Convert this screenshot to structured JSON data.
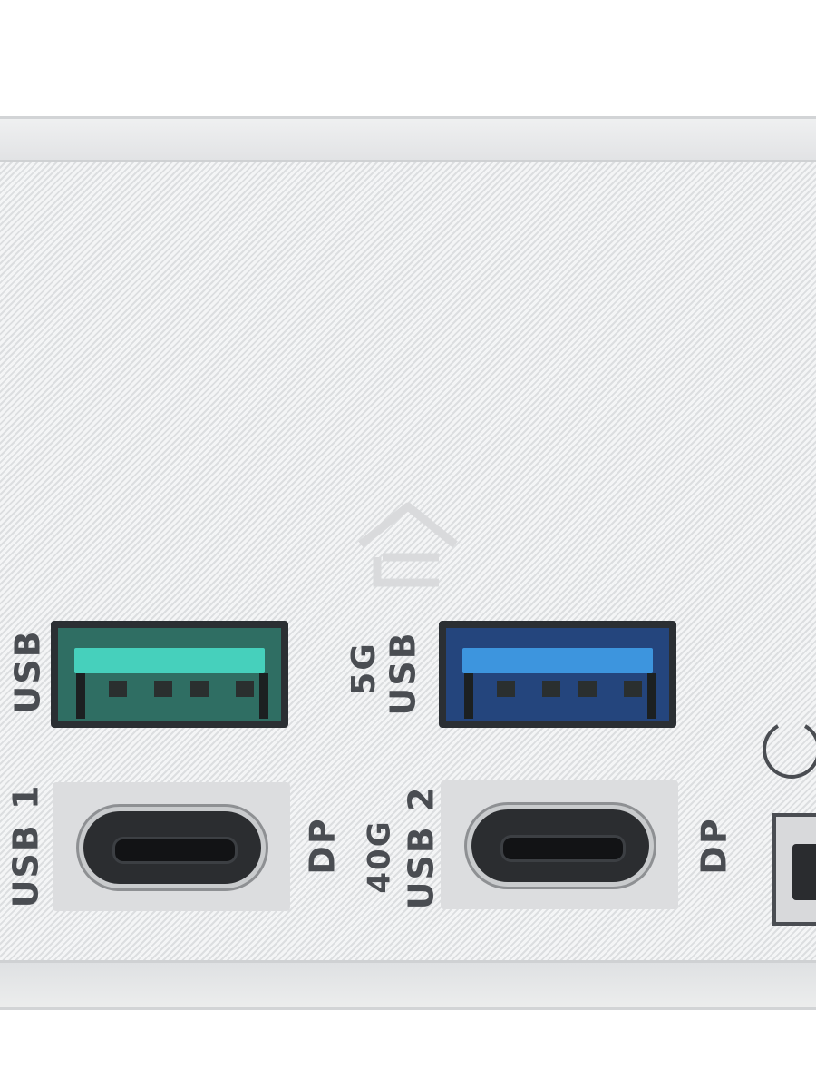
{
  "device": {
    "ports": {
      "usb_a_left": {
        "label": "USB",
        "tongue_color": "#3ec9b5",
        "body_color": "#2f6e63"
      },
      "usb_a_right": {
        "label_top": "5G",
        "label_bottom": "USB",
        "tongue_color": "#3c8fd8",
        "body_color": "#24457d"
      },
      "usb_c_left": {
        "label": "USB 1",
        "side_label": "DP"
      },
      "usb_c_right": {
        "label_top": "40G",
        "label_bottom": "USB 2",
        "side_label": "DP"
      }
    },
    "logo": "home-outline-icon",
    "colors": {
      "panel": "#e9eaeb",
      "label_text": "#4a4d52"
    }
  }
}
